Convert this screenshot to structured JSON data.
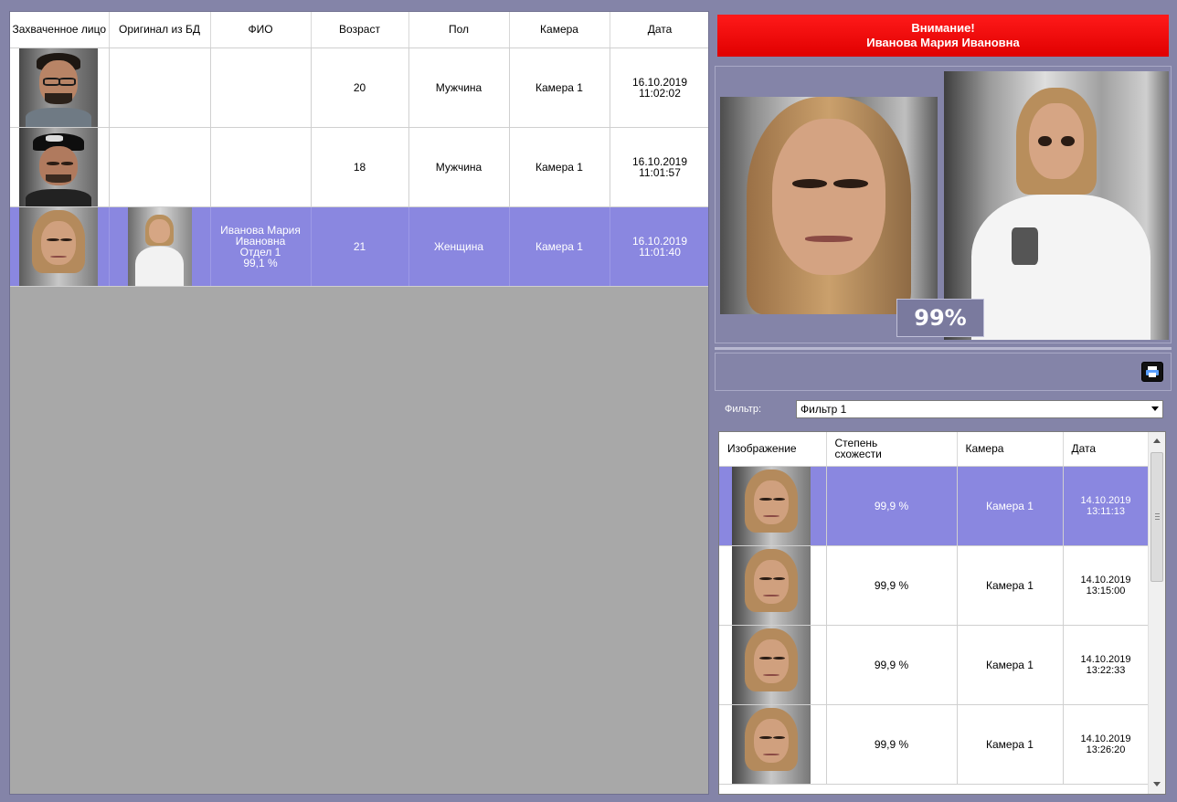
{
  "events": {
    "columns": [
      "Захваченное лицо",
      "Оригинал из БД",
      "ФИО",
      "Возраст",
      "Пол",
      "Камера",
      "Дата"
    ],
    "rows": [
      {
        "name": "",
        "age": "20",
        "gender": "Мужчина",
        "camera": "Камера 1",
        "date": "16.10.2019",
        "time": "11:02:02"
      },
      {
        "name": "",
        "age": "18",
        "gender": "Мужчина",
        "camera": "Камера 1",
        "date": "16.10.2019",
        "time": "11:01:57"
      },
      {
        "name": "Иванова Мария Ивановна",
        "department": "Отдел 1",
        "similarity": "99,1 %",
        "age": "21",
        "gender": "Женщина",
        "camera": "Камера 1",
        "date": "16.10.2019",
        "time": "11:01:40"
      }
    ]
  },
  "alert": {
    "title": "Внимание!",
    "person": "Иванова Мария Ивановна"
  },
  "match": {
    "percent": "99%"
  },
  "filter": {
    "label": "Фильтр:",
    "value": "Фильтр 1"
  },
  "history": {
    "columns": [
      "Изображение",
      "Степень схожести",
      "Камера",
      "Дата"
    ],
    "rows": [
      {
        "similarity": "99,9 %",
        "camera": "Камера 1",
        "date": "14.10.2019 13:11:13"
      },
      {
        "similarity": "99,9 %",
        "camera": "Камера 1",
        "date": "14.10.2019 13:15:00"
      },
      {
        "similarity": "99,9 %",
        "camera": "Камера 1",
        "date": "14.10.2019 13:22:33"
      },
      {
        "similarity": "99,9 %",
        "camera": "Камера 1",
        "date": "14.10.2019 13:26:20"
      }
    ]
  },
  "icons": {
    "print": "print-icon",
    "dropdown": "chevron-down-icon",
    "scroll_up": "arrow-up-icon",
    "scroll_down": "arrow-down-icon"
  },
  "colors": {
    "background": "#8484a8",
    "selection": "#8a87e0",
    "alert": "#ff0000",
    "empty_area": "#a8a8a8"
  }
}
